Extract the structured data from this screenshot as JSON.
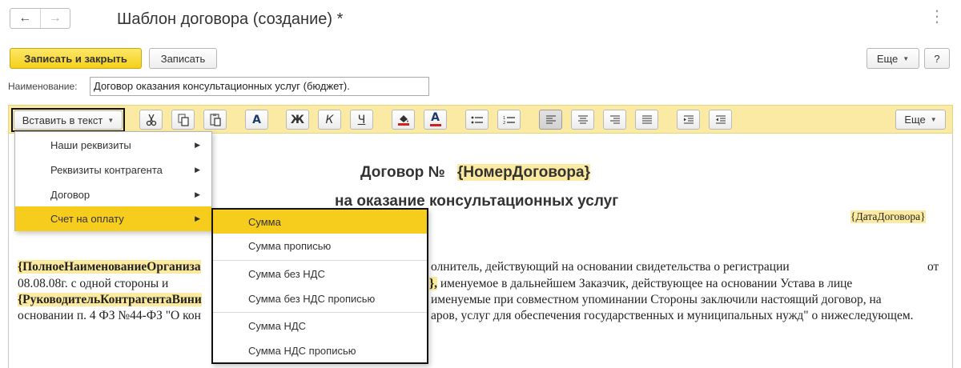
{
  "window": {
    "title": "Шаблон договора (создание) *",
    "nav_back": "←",
    "nav_forward": "→",
    "more_dots": "⋮"
  },
  "actions": {
    "save_close": "Записать и закрыть",
    "save": "Записать",
    "more": "Еще",
    "help": "?"
  },
  "form": {
    "name_label": "Наименование:",
    "name_value": "Договор оказания консультационных услуг (бюджет)."
  },
  "toolbar": {
    "insert_label": "Вставить в текст",
    "more": "Еще",
    "bold_char": "Ж",
    "italic_char": "К",
    "underline_char": "Ч",
    "font_char": "A",
    "font_color_char": "A"
  },
  "insert_menu": {
    "items": [
      {
        "label": "Наши реквизиты"
      },
      {
        "label": "Реквизиты контрагента"
      },
      {
        "label": "Договор"
      },
      {
        "label": "Счет на оплату"
      }
    ]
  },
  "submenu": {
    "items": [
      {
        "label": "Сумма"
      },
      {
        "label": "Сумма прописью"
      },
      {
        "label": "Сумма без НДС"
      },
      {
        "label": "Сумма без НДС прописью"
      },
      {
        "label": "Сумма НДС"
      },
      {
        "label": "Сумма НДС прописью"
      }
    ]
  },
  "document": {
    "title_prefix": "Договор №",
    "title_field": "{НомерДоговора}",
    "subtitle": "на оказание консультационных услуг",
    "date_field": "{ДатаДоговора}",
    "p1_field": "{ПолноеНаименованиеОрганиза",
    "p1_rest": "олнитель, действующий на основании свидетельства о регистрации",
    "p1_end": "от",
    "p2_start": "08.08.08г. с одной стороны и",
    "p2_field_tail": "},",
    "p2_rest": " именуемое в дальнейшем Заказчик, действующее на основании Устава в лице",
    "p3_field": "{РуководительКонтрагентаВини",
    "p3_rest": "именуемые при совместном упоминании Стороны заключили настоящий договор, на",
    "p4_start": "основании п. 4 ФЗ №44-ФЗ \"О кон",
    "p4_rest": "аров, услуг для обеспечения государственных и муниципальных нужд\" о нижеследующем."
  }
}
